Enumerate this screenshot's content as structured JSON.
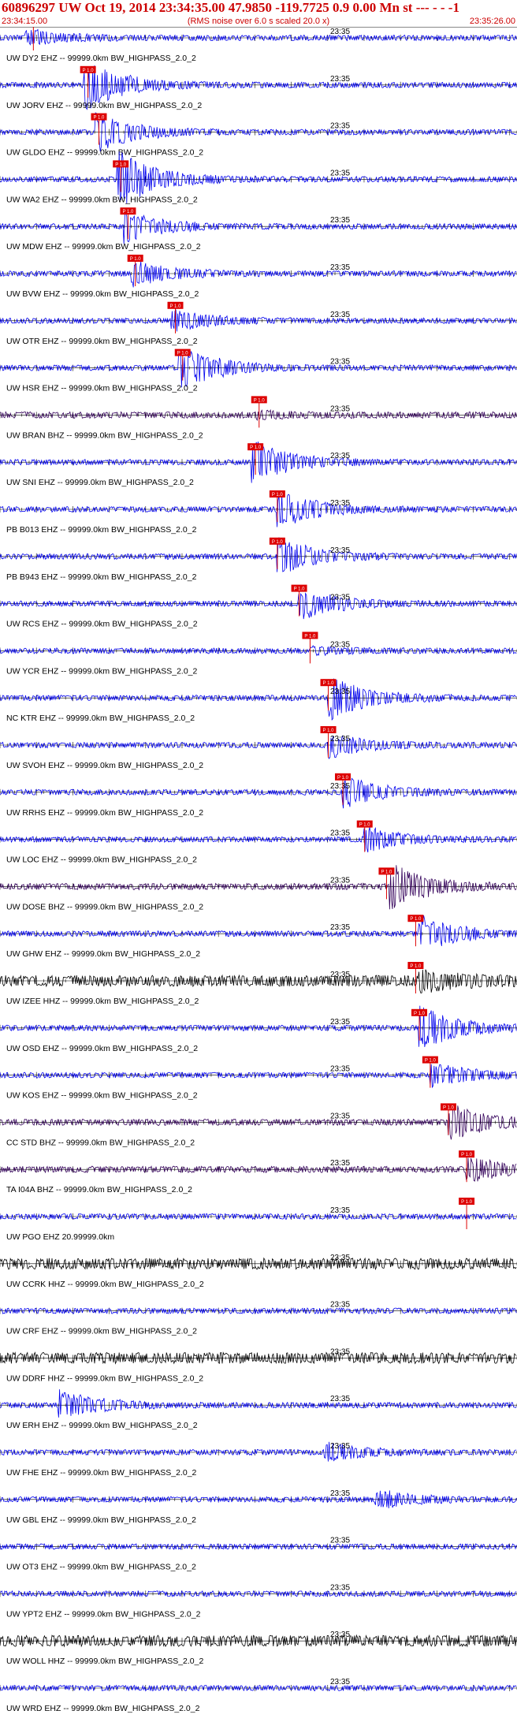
{
  "header": {
    "title": "60896297 UW Oct 19, 2014 23:34:35.00   47.9850 -119.7725  0.9 0.00 Mn st --- - - -1",
    "start_time": "23:34:15.00",
    "note": "(RMS noise over 6.0 s scaled 20.0 x)",
    "end_time": "23:35:26.00"
  },
  "colors": {
    "trace_blue": "#0000ee",
    "trace_black": "#000000",
    "trace_purple": "#33005a",
    "pick_red": "#dd0000",
    "header_red": "#cc0000"
  },
  "chart_data": {
    "type": "line",
    "title": "60896297 UW Oct 19, 2014 23:34:35.00   47.9850 -119.7725  0.9 0.00 Mn st --- - - -1",
    "x_range": [
      "23:34:15.00",
      "23:35:26.00"
    ],
    "minute_mark": "23:35",
    "pick_label": "P 1.0",
    "series": [
      {
        "name": "UW DY2 EHZ -- 99999.0km BW_HIGHPASS_2.0_2",
        "color": "blue",
        "pick_time_s": 3.5,
        "event_time_s": 4.0,
        "amplitude": 0.25
      },
      {
        "name": "UW JORV EHZ -- 99999.0km BW_HIGHPASS_2.0_2",
        "color": "blue",
        "pick_time_s": 11.0,
        "event_time_s": 12.0,
        "amplitude": 0.8
      },
      {
        "name": "UW GLDO EHZ -- 99999.0km BW_HIGHPASS_2.0_2",
        "color": "blue",
        "pick_time_s": 12.5,
        "event_time_s": 13.5,
        "amplitude": 0.6
      },
      {
        "name": "UW WA2 EHZ -- 99999.0km BW_HIGHPASS_2.0_2",
        "color": "blue",
        "pick_time_s": 15.5,
        "event_time_s": 16.5,
        "amplitude": 0.9
      },
      {
        "name": "UW MDW EHZ -- 99999.0km BW_HIGHPASS_2.0_2",
        "color": "blue",
        "pick_time_s": 16.5,
        "event_time_s": 17.5,
        "amplitude": 0.5
      },
      {
        "name": "UW BVW EHZ -- 99999.0km BW_HIGHPASS_2.0_2",
        "color": "blue",
        "pick_time_s": 17.5,
        "event_time_s": 18.5,
        "amplitude": 0.4
      },
      {
        "name": "UW OTR EHZ -- 99999.0km BW_HIGHPASS_2.0_2",
        "color": "blue",
        "pick_time_s": 23.0,
        "event_time_s": 24.0,
        "amplitude": 0.35
      },
      {
        "name": "UW HSR EHZ -- 99999.0km BW_HIGHPASS_2.0_2",
        "color": "blue",
        "pick_time_s": 24.0,
        "event_time_s": 25.0,
        "amplitude": 0.7
      },
      {
        "name": "UW BRAN BHZ -- 99999.0km BW_HIGHPASS_2.0_2",
        "color": "purple",
        "pick_time_s": 34.5,
        "event_time_s": 35.5,
        "amplitude": 0.1
      },
      {
        "name": "UW SNI EHZ -- 99999.0km BW_HIGHPASS_2.0_2",
        "color": "blue",
        "pick_time_s": 34.0,
        "event_time_s": 35.0,
        "amplitude": 0.7
      },
      {
        "name": "PB B013 EHZ -- 99999.0km BW_HIGHPASS_2.0_2",
        "color": "blue",
        "pick_time_s": 37.0,
        "event_time_s": 38.5,
        "amplitude": 0.6
      },
      {
        "name": "PB B943 EHZ -- 99999.0km BW_HIGHPASS_2.0_2",
        "color": "blue",
        "pick_time_s": 37.0,
        "event_time_s": 38.5,
        "amplitude": 0.6
      },
      {
        "name": "UW RCS EHZ -- 99999.0km BW_HIGHPASS_2.0_2",
        "color": "blue",
        "pick_time_s": 40.0,
        "event_time_s": 41.5,
        "amplitude": 0.5
      },
      {
        "name": "UW YCR EHZ -- 99999.0km BW_HIGHPASS_2.0_2",
        "color": "blue",
        "pick_time_s": 41.5,
        "event_time_s": 43.0,
        "amplitude": 0.1
      },
      {
        "name": "NC KTR EHZ -- 99999.0km BW_HIGHPASS_2.0_2",
        "color": "blue",
        "pick_time_s": 44.0,
        "event_time_s": 45.5,
        "amplitude": 0.7
      },
      {
        "name": "UW SVOH EHZ -- 99999.0km BW_HIGHPASS_2.0_2",
        "color": "blue",
        "pick_time_s": 44.0,
        "event_time_s": 45.5,
        "amplitude": 0.4
      },
      {
        "name": "UW RRHS EHZ -- 99999.0km BW_HIGHPASS_2.0_2",
        "color": "blue",
        "pick_time_s": 46.0,
        "event_time_s": 47.5,
        "amplitude": 0.5
      },
      {
        "name": "UW LOC EHZ -- 99999.0km BW_HIGHPASS_2.0_2",
        "color": "blue",
        "pick_time_s": 49.0,
        "event_time_s": 50.5,
        "amplitude": 0.4
      },
      {
        "name": "UW DOSE BHZ -- 99999.0km BW_HIGHPASS_2.0_2",
        "color": "purple",
        "pick_time_s": 52.0,
        "event_time_s": 54.0,
        "amplitude": 0.7
      },
      {
        "name": "UW GHW EHZ -- 99999.0km BW_HIGHPASS_2.0_2",
        "color": "blue",
        "pick_time_s": 56.0,
        "event_time_s": 58.0,
        "amplitude": 0.6
      },
      {
        "name": "UW IZEE HHZ -- 99999.0km BW_HIGHPASS_2.0_2",
        "color": "black",
        "pick_time_s": 56.0,
        "event_time_s": 58.0,
        "amplitude": 0.3
      },
      {
        "name": "UW OSD EHZ -- 99999.0km BW_HIGHPASS_2.0_2",
        "color": "blue",
        "pick_time_s": 56.5,
        "event_time_s": 58.0,
        "amplitude": 0.7
      },
      {
        "name": "UW KOS EHZ -- 99999.0km BW_HIGHPASS_2.0_2",
        "color": "blue",
        "pick_time_s": 58.0,
        "event_time_s": 59.5,
        "amplitude": 0.4
      },
      {
        "name": "CC STD BHZ -- 99999.0km BW_HIGHPASS_2.0_2",
        "color": "purple",
        "pick_time_s": 60.5,
        "event_time_s": 62.0,
        "amplitude": 0.6
      },
      {
        "name": "TA I04A BHZ -- 99999.0km BW_HIGHPASS_2.0_2",
        "color": "purple",
        "pick_time_s": 63.0,
        "event_time_s": 64.5,
        "amplitude": 0.4
      },
      {
        "name": "UW PGO EHZ 20.99999.0km",
        "color": "blue",
        "pick_time_s": 63.0,
        "event_time_s": null,
        "amplitude": 0.0
      },
      {
        "name": "UW CCRK HHZ -- 99999.0km BW_HIGHPASS_2.0_2",
        "color": "black",
        "pick_time_s": null,
        "event_time_s": null,
        "amplitude": 0.0
      },
      {
        "name": "UW CRF EHZ -- 99999.0km BW_HIGHPASS_2.0_2",
        "color": "blue",
        "pick_time_s": null,
        "event_time_s": null,
        "amplitude": 0.0
      },
      {
        "name": "UW DDRF HHZ -- 99999.0km BW_HIGHPASS_2.0_2",
        "color": "black",
        "pick_time_s": null,
        "event_time_s": null,
        "amplitude": 0.0
      },
      {
        "name": "UW ERH EHZ -- 99999.0km BW_HIGHPASS_2.0_2",
        "color": "blue",
        "pick_time_s": null,
        "event_time_s": 8.5,
        "amplitude": 0.5
      },
      {
        "name": "UW FHE EHZ -- 99999.0km BW_HIGHPASS_2.0_2",
        "color": "blue",
        "pick_time_s": null,
        "event_time_s": 45.0,
        "amplitude": 0.3
      },
      {
        "name": "UW GBL EHZ -- 99999.0km BW_HIGHPASS_2.0_2",
        "color": "blue",
        "pick_time_s": null,
        "event_time_s": 52.0,
        "amplitude": 0.3
      },
      {
        "name": "UW OT3 EHZ -- 99999.0km BW_HIGHPASS_2.0_2",
        "color": "blue",
        "pick_time_s": null,
        "event_time_s": null,
        "amplitude": 0.0
      },
      {
        "name": "UW YPT2 EHZ -- 99999.0km BW_HIGHPASS_2.0_2",
        "color": "blue",
        "pick_time_s": null,
        "event_time_s": null,
        "amplitude": 0.0
      },
      {
        "name": "UW WOLL HHZ -- 99999.0km BW_HIGHPASS_2.0_2",
        "color": "black",
        "pick_time_s": null,
        "event_time_s": null,
        "amplitude": 0.0
      },
      {
        "name": "UW WRD EHZ -- 99999.0km BW_HIGHPASS_2.0_2",
        "color": "blue",
        "pick_time_s": null,
        "event_time_s": null,
        "amplitude": 0.0
      }
    ]
  }
}
